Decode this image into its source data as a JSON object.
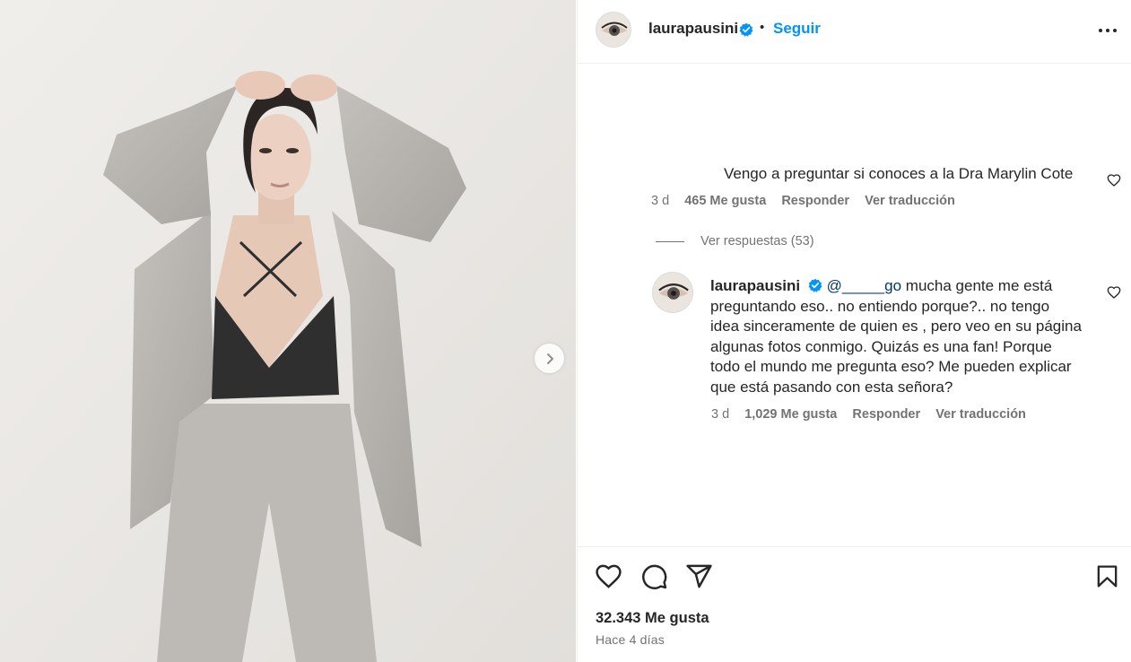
{
  "post": {
    "author": "laurapausini",
    "follow_label": "Seguir",
    "dot": "•",
    "likes_text": "32.343 Me gusta",
    "time_ago": "Hace 4 días"
  },
  "comments": [
    {
      "text": "Vengo a preguntar si conoces a la Dra Marylin Cote",
      "age": "3 d",
      "likes": "465 Me gusta",
      "reply_label": "Responder",
      "translate_label": "Ver traducción"
    }
  ],
  "view_replies": "Ver respuestas (53)",
  "reply": {
    "author": "laurapausini",
    "mention": "@_____go",
    "line1": "mucha gente me está",
    "lines": [
      "preguntando eso.. no entiendo porque?.. no tengo",
      "idea sinceramente de quien es , pero veo en su página",
      "algunas fotos conmigo. Quizás es una fan! Porque",
      "todo el mundo me pregunta eso? Me pueden explicar",
      "que está pasando con esta señora?"
    ],
    "age": "3 d",
    "likes": "1,029 Me gusta",
    "reply_label": "Responder",
    "translate_label": "Ver traducción"
  },
  "icons": {
    "verified": "verified-badge-icon",
    "more": "more-options-icon",
    "like": "heart-icon",
    "comment": "comment-icon",
    "share": "share-icon",
    "save": "bookmark-icon",
    "next": "chevron-right-icon"
  },
  "colors": {
    "accent": "#0095f6",
    "text": "#262626",
    "muted": "#737373",
    "mention": "#00376b",
    "verified": "#0095f6"
  }
}
